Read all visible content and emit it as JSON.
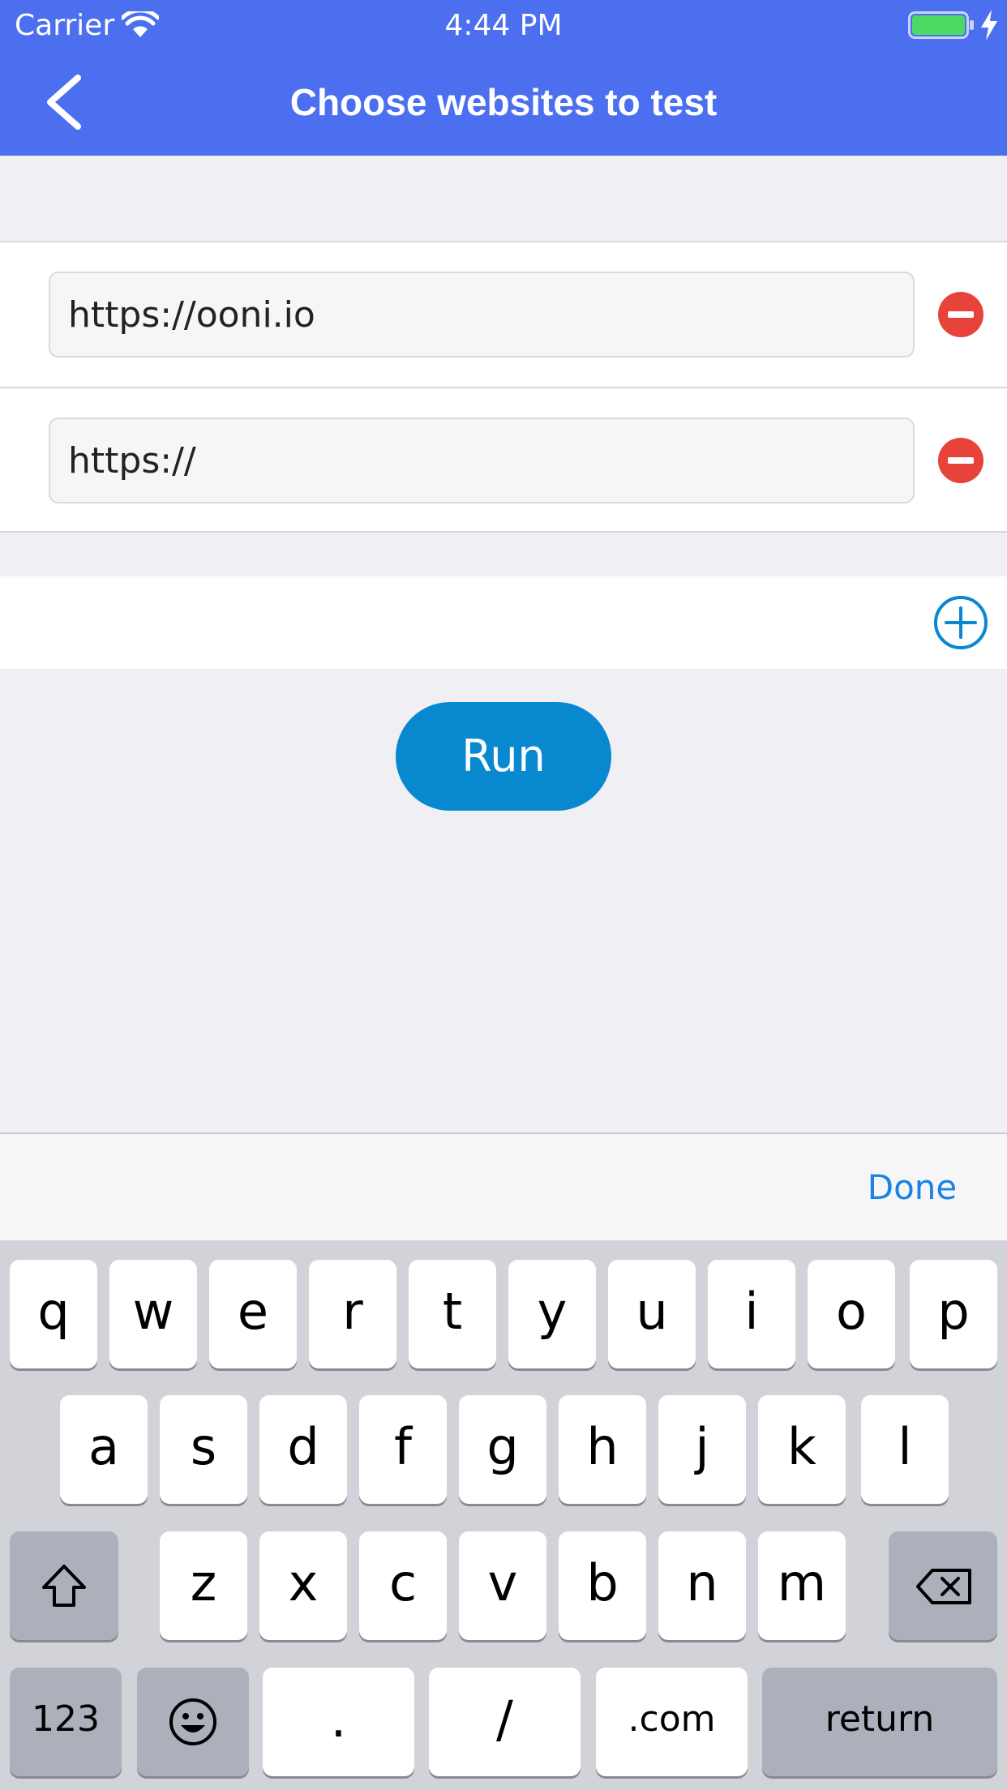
{
  "status_bar": {
    "carrier": "Carrier",
    "time": "4:44 PM",
    "battery_color": "#4cd964"
  },
  "nav": {
    "title": "Choose websites to test",
    "background_color": "#4c6ff0",
    "back_icon": "chevron-left-icon"
  },
  "urls": [
    {
      "value": "https://ooni.io",
      "remove_icon": "minus-circle-icon"
    },
    {
      "value": "https://",
      "remove_icon": "minus-circle-icon"
    }
  ],
  "add_icon": "plus-circle-icon",
  "run_button": {
    "label": "Run",
    "color": "#0788cf"
  },
  "accessory": {
    "done_label": "Done",
    "done_color": "#1a82e8"
  },
  "keyboard": {
    "row1": [
      "q",
      "w",
      "e",
      "r",
      "t",
      "y",
      "u",
      "i",
      "o",
      "p"
    ],
    "row2": [
      "a",
      "s",
      "d",
      "f",
      "g",
      "h",
      "j",
      "k",
      "l"
    ],
    "row3": [
      "z",
      "x",
      "c",
      "v",
      "b",
      "n",
      "m"
    ],
    "shift_icon": "shift-arrow-icon",
    "delete_icon": "backspace-icon",
    "numbers_label": "123",
    "emoji_icon": "smiley-face-icon",
    "period_label": ".",
    "slash_label": "/",
    "dotcom_label": ".com",
    "return_label": "return"
  }
}
